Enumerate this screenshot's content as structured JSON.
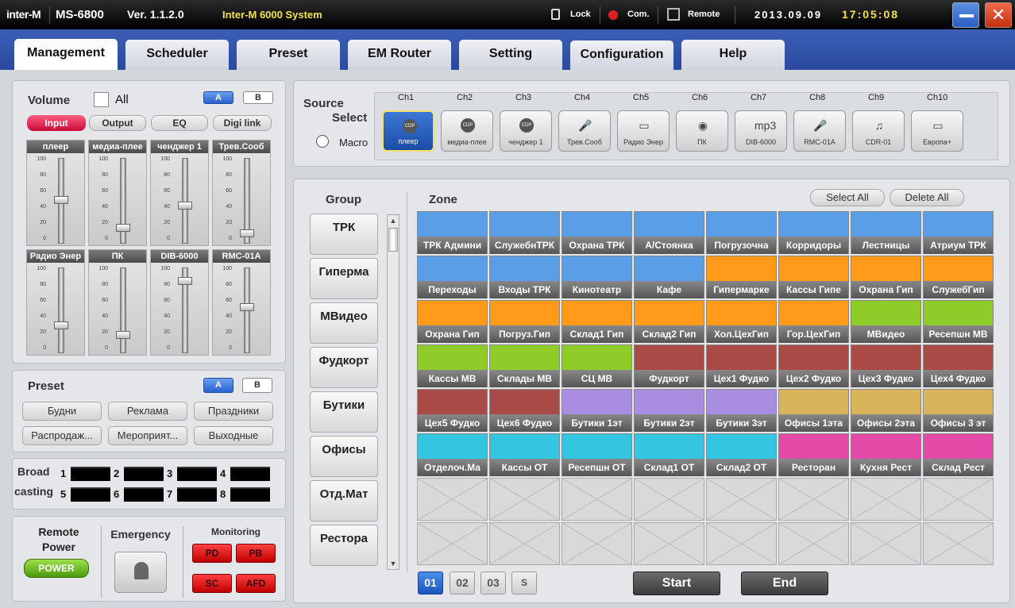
{
  "title": {
    "logo": "inter-M",
    "model": "MS-6800",
    "version": "Ver. 1.1.2.0",
    "system": "Inter-M 6000 System",
    "lock": "Lock",
    "com": "Com.",
    "remote": "Remote",
    "date": "2013.09.09",
    "time": "17:05:08"
  },
  "tabs": [
    "Management",
    "Scheduler",
    "Preset",
    "EM Router",
    "Setting",
    "Configuration",
    "Help"
  ],
  "volume": {
    "title": "Volume",
    "all": "All",
    "a": "A",
    "b": "B",
    "modes": [
      "Input",
      "Output",
      "EQ",
      "Digi link"
    ],
    "scale": [
      "100",
      "80",
      "60",
      "40",
      "20",
      "0"
    ],
    "channels": [
      {
        "name": "плеер",
        "level": 0.52
      },
      {
        "name": "медиа-плее",
        "level": 0.17
      },
      {
        "name": "ченджер 1",
        "level": 0.45
      },
      {
        "name": "Трев.Сооб",
        "level": 0.1
      },
      {
        "name": "Радио Энер",
        "level": 0.32
      },
      {
        "name": "ПК",
        "level": 0.2
      },
      {
        "name": "DIB-6000",
        "level": 0.88
      },
      {
        "name": "RMC-01A",
        "level": 0.55
      }
    ]
  },
  "preset": {
    "title": "Preset",
    "a": "A",
    "b": "B",
    "items": [
      "Будни",
      "Реклама",
      "Праздники",
      "Распродаж...",
      "Мероприят...",
      "Выходные"
    ]
  },
  "broadcasting": {
    "label1": "Broad",
    "label2": "casting",
    "nums": [
      "1",
      "2",
      "3",
      "4",
      "5",
      "6",
      "7",
      "8"
    ]
  },
  "bottom": {
    "remote1": "Remote",
    "remote2": "Power",
    "power": "POWER",
    "emergency": "Emergency",
    "monitoring": "Monitoring",
    "mon": [
      "PD",
      "PB",
      "SC",
      "AFD"
    ]
  },
  "source": {
    "title1": "Source",
    "title2": "Select",
    "macro": "Macro",
    "channels": [
      {
        "ch": "Ch1",
        "label": "плеер",
        "icon": "CDP"
      },
      {
        "ch": "Ch2",
        "label": "медиа-плее",
        "icon": "CDP"
      },
      {
        "ch": "Ch3",
        "label": "ченджер 1",
        "icon": "CDP"
      },
      {
        "ch": "Ch4",
        "label": "Трев.Сооб",
        "icon": "mic"
      },
      {
        "ch": "Ch5",
        "label": "Радио Энер",
        "icon": "radio"
      },
      {
        "ch": "Ch6",
        "label": "ПК",
        "icon": "pc"
      },
      {
        "ch": "Ch7",
        "label": "DIB-6000",
        "icon": "mp3"
      },
      {
        "ch": "Ch8",
        "label": "RMC-01A",
        "icon": "mic"
      },
      {
        "ch": "Ch9",
        "label": "CDR-01",
        "icon": "note"
      },
      {
        "ch": "Ch10",
        "label": "Европа+",
        "icon": "radio"
      }
    ]
  },
  "group": {
    "title": "Group",
    "items": [
      "ТРК",
      "Гиперма",
      "МВидео",
      "Фудкорт",
      "Бутики",
      "Офисы",
      "Отд.Мат",
      "Рестора"
    ]
  },
  "zone": {
    "title": "Zone",
    "select_all": "Select All",
    "delete_all": "Delete All",
    "colors": {
      "blue": "#5b9ee8",
      "orange": "#ff9a1a",
      "green": "#8fcc2a",
      "red": "#a94a46",
      "purple": "#a98de0",
      "gold": "#d9b45a",
      "cyan": "#34c6e0",
      "pink": "#e34aa8"
    },
    "cells": [
      {
        "name": "ТРК Админи",
        "c": "blue"
      },
      {
        "name": "СлужебнТРК",
        "c": "blue"
      },
      {
        "name": "Охрана ТРК",
        "c": "blue"
      },
      {
        "name": "А/Стоянка",
        "c": "blue"
      },
      {
        "name": "Погрузочна",
        "c": "blue"
      },
      {
        "name": "Корридоры",
        "c": "blue"
      },
      {
        "name": "Лестницы",
        "c": "blue"
      },
      {
        "name": "Атриум ТРК",
        "c": "blue"
      },
      {
        "name": "Переходы",
        "c": "blue"
      },
      {
        "name": "Входы ТРК",
        "c": "blue"
      },
      {
        "name": "Кинотеатр",
        "c": "blue"
      },
      {
        "name": "Кафе",
        "c": "blue"
      },
      {
        "name": "Гипермарке",
        "c": "orange"
      },
      {
        "name": "Кассы Гипе",
        "c": "orange"
      },
      {
        "name": "Охрана Гип",
        "c": "orange"
      },
      {
        "name": "СлужебГип",
        "c": "orange"
      },
      {
        "name": "Охрана Гип",
        "c": "orange"
      },
      {
        "name": "Погруз.Гип",
        "c": "orange"
      },
      {
        "name": "Склад1 Гип",
        "c": "orange"
      },
      {
        "name": "Склад2 Гип",
        "c": "orange"
      },
      {
        "name": "Хол.ЦехГип",
        "c": "orange"
      },
      {
        "name": "Гор.ЦехГип",
        "c": "orange"
      },
      {
        "name": "МВидео",
        "c": "green"
      },
      {
        "name": "Ресепшн МВ",
        "c": "green"
      },
      {
        "name": "Кассы МВ",
        "c": "green"
      },
      {
        "name": "Склады МВ",
        "c": "green"
      },
      {
        "name": "СЦ МВ",
        "c": "green"
      },
      {
        "name": "Фудкорт",
        "c": "red"
      },
      {
        "name": "Цех1 Фудко",
        "c": "red"
      },
      {
        "name": "Цех2 Фудко",
        "c": "red"
      },
      {
        "name": "Цех3 Фудко",
        "c": "red"
      },
      {
        "name": "Цех4 Фудко",
        "c": "red"
      },
      {
        "name": "Цех5 Фудко",
        "c": "red"
      },
      {
        "name": "Цех6 Фудко",
        "c": "red"
      },
      {
        "name": "Бутики 1эт",
        "c": "purple"
      },
      {
        "name": "Бутики 2эт",
        "c": "purple"
      },
      {
        "name": "Бутики 3эт",
        "c": "purple"
      },
      {
        "name": "Офисы 1эта",
        "c": "gold"
      },
      {
        "name": "Офисы 2эта",
        "c": "gold"
      },
      {
        "name": "Офисы 3 эт",
        "c": "gold"
      },
      {
        "name": "Отделоч.Ма",
        "c": "cyan"
      },
      {
        "name": "Кассы ОТ",
        "c": "cyan"
      },
      {
        "name": "Ресепшн ОТ",
        "c": "cyan"
      },
      {
        "name": "Склад1 ОТ",
        "c": "cyan"
      },
      {
        "name": "Склад2 ОТ",
        "c": "cyan"
      },
      {
        "name": "Ресторан",
        "c": "pink"
      },
      {
        "name": "Кухня Рест",
        "c": "pink"
      },
      {
        "name": "Склад Рест",
        "c": "pink"
      }
    ],
    "pages": [
      "01",
      "02",
      "03",
      "S"
    ],
    "start": "Start",
    "end": "End"
  }
}
